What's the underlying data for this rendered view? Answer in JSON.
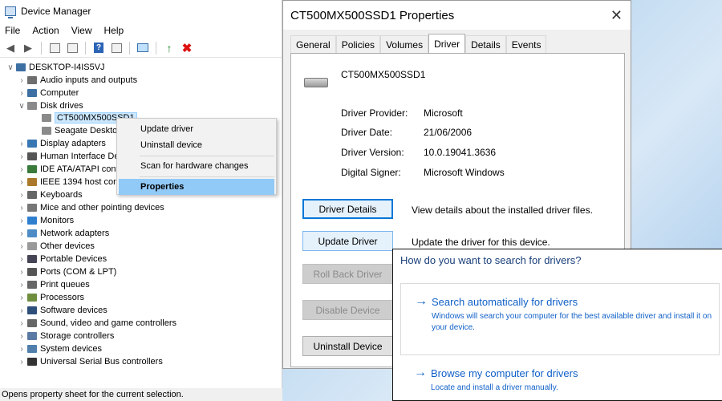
{
  "device_manager": {
    "title": "Device Manager",
    "menu": [
      "File",
      "Action",
      "View",
      "Help"
    ],
    "tree": {
      "root": "DESKTOP-I4IS5VJ",
      "items": [
        "Audio inputs and outputs",
        "Computer",
        "Disk drives",
        "CT500MX500SSD1",
        "Seagate Desktop",
        "Display adapters",
        "Human Interface De",
        "IDE ATA/ATAPI contro",
        "IEEE 1394 host cont",
        "Keyboards",
        "Mice and other pointing devices",
        "Monitors",
        "Network adapters",
        "Other devices",
        "Portable Devices",
        "Ports (COM & LPT)",
        "Print queues",
        "Processors",
        "Software devices",
        "Sound, video and game controllers",
        "Storage controllers",
        "System devices",
        "Universal Serial Bus controllers"
      ]
    },
    "status": "Opens property sheet for the current selection."
  },
  "context_menu": {
    "items": [
      "Update driver",
      "Uninstall device",
      "Scan for hardware changes",
      "Properties"
    ]
  },
  "properties": {
    "title": "CT500MX500SSD1 Properties",
    "tabs": [
      "General",
      "Policies",
      "Volumes",
      "Driver",
      "Details",
      "Events"
    ],
    "active_tab": "Driver",
    "device_name": "CT500MX500SSD1",
    "info": {
      "provider_label": "Driver Provider:",
      "provider": "Microsoft",
      "date_label": "Driver Date:",
      "date": "21/06/2006",
      "version_label": "Driver Version:",
      "version": "10.0.19041.3636",
      "signer_label": "Digital Signer:",
      "signer": "Microsoft Windows"
    },
    "buttons": {
      "details": "Driver Details",
      "details_desc": "View details about the installed driver files.",
      "update": "Update Driver",
      "update_desc": "Update the driver for this device.",
      "rollback": "Roll Back Driver",
      "disable": "Disable Device",
      "uninstall": "Uninstall Device"
    }
  },
  "update_driver": {
    "question": "How do you want to search for drivers?",
    "auto_title": "Search automatically for drivers",
    "auto_desc": "Windows will search your computer for the best available driver and install it on your device.",
    "browse_title": "Browse my computer for drivers",
    "browse_desc": "Locate and install a driver manually."
  }
}
